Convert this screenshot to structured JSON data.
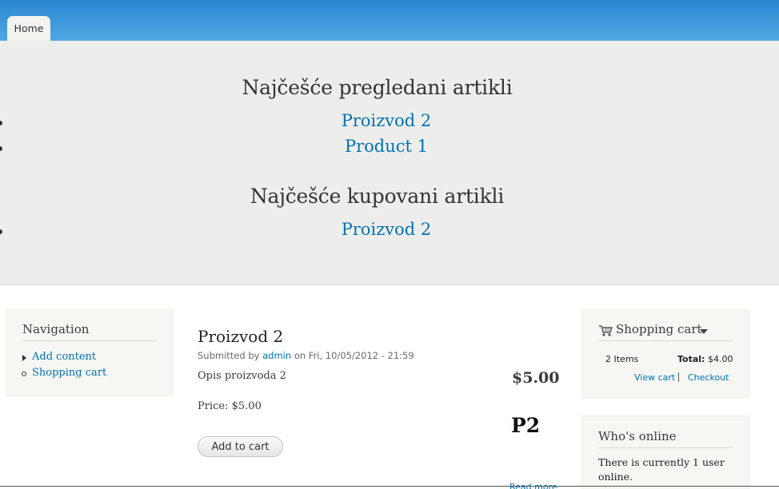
{
  "header": {
    "tabs": [
      {
        "label": "Home"
      }
    ],
    "accent": "#2a86cf"
  },
  "featured": {
    "most_viewed": {
      "title": "Najčešće pregledani artikli",
      "items": [
        "Proizvod 2",
        "Product 1"
      ]
    },
    "most_bought": {
      "title": "Najčešće kupovani artikli",
      "items": [
        "Proizvod 2"
      ]
    },
    "link_color": "#0071b3"
  },
  "navigation": {
    "title": "Navigation",
    "items": [
      "Add content",
      "Shopping cart"
    ]
  },
  "node": {
    "title": "Proizvod 2",
    "submitted_prefix": "Submitted by",
    "author": "admin",
    "submitted_suffix": "on Fri, 10/05/2012 - 21:59",
    "body": "Opis proizvoda 2",
    "price_label": "Price:",
    "price_value": "$5.00",
    "display_price": "$5.00",
    "sku": "P2",
    "add_to_cart_label": "Add to cart",
    "read_more_label": "Read more"
  },
  "cart": {
    "title": "Shopping cart",
    "items_count": "2 Items",
    "total_label": "Total:",
    "total_value": "$4.00",
    "view_cart_label": "View cart",
    "checkout_label": "Checkout",
    "icon": "cart-icon"
  },
  "whos_online": {
    "title": "Who's online",
    "text": "There is currently 1 user online."
  }
}
